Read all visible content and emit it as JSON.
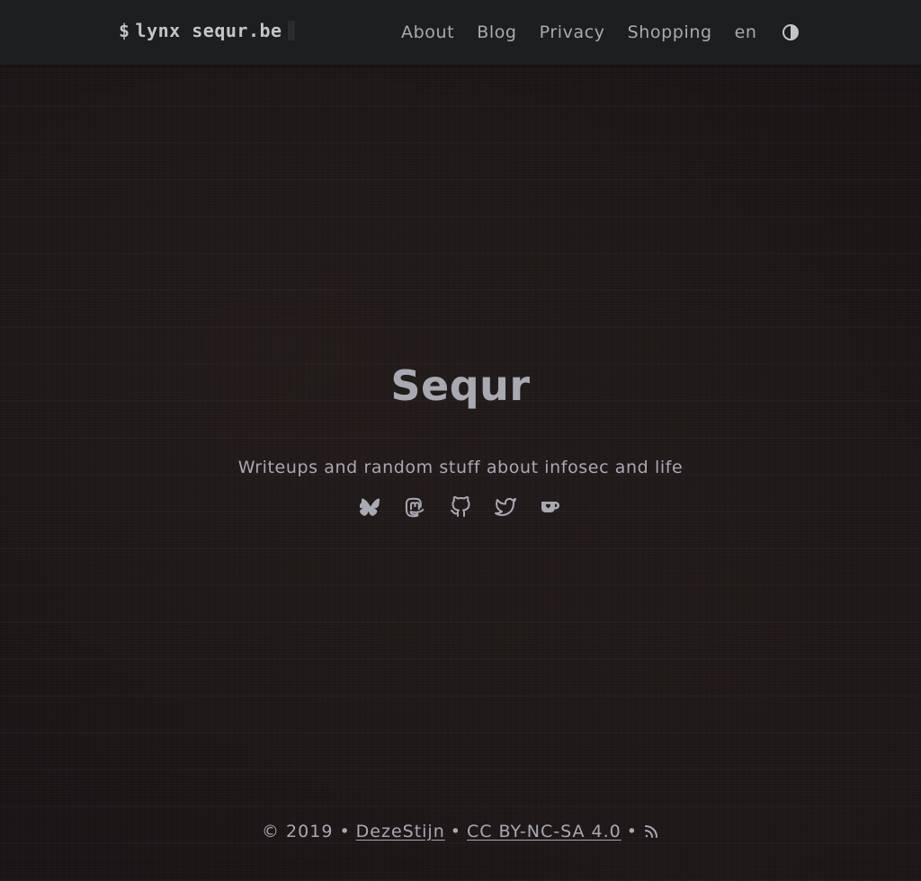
{
  "header": {
    "logo_mark": "$",
    "logo_text": "lynx sequr.be",
    "nav": [
      {
        "label": "About"
      },
      {
        "label": "Blog"
      },
      {
        "label": "Privacy"
      },
      {
        "label": "Shopping"
      }
    ],
    "language": "en",
    "theme_toggle_icon": "contrast-icon"
  },
  "hero": {
    "title": "Sequr",
    "tagline": "Writeups and random stuff about infosec and life",
    "socials": [
      {
        "icon": "bluesky-icon"
      },
      {
        "icon": "mastodon-icon"
      },
      {
        "icon": "github-icon"
      },
      {
        "icon": "twitter-icon"
      },
      {
        "icon": "kofi-icon"
      }
    ]
  },
  "footer": {
    "copyright": "© 2019 •",
    "author": "DezeStijn",
    "sep1": "•",
    "license": "CC BY-NC-SA 4.0",
    "sep2": "•",
    "rss_icon": "rss-icon"
  },
  "colors": {
    "background": "#1a1516",
    "header": "#1d1e20",
    "text": "#a9a9b3"
  }
}
